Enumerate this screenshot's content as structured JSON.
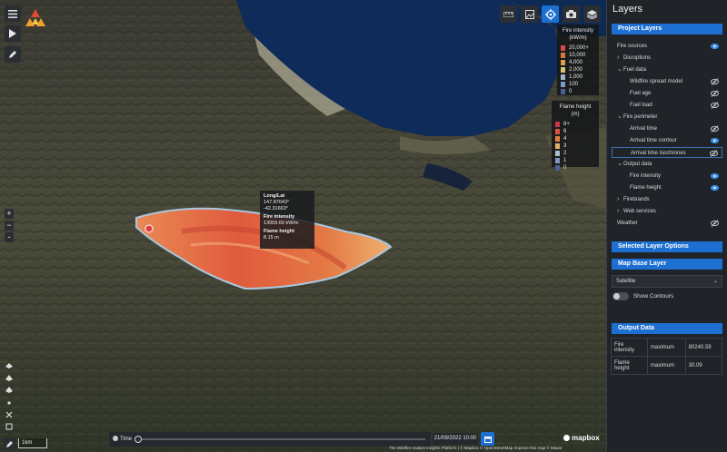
{
  "map": {
    "scale": "1km",
    "attribution": "The Wildfire Analyst Insights Platform | © Mapbox © OpenStreetMap Improve this map © Maxar",
    "mapbox_logo": "mapbox",
    "zoom_in": "+",
    "zoom_out": "−",
    "compass": "-"
  },
  "legends": {
    "fire_intensity": {
      "title": "Fire intensity (kW/m)",
      "items": [
        {
          "label": "20,000+",
          "color": "#d24a4a"
        },
        {
          "label": "10,000",
          "color": "#d9753e"
        },
        {
          "label": "4,000",
          "color": "#e0a146"
        },
        {
          "label": "2,000",
          "color": "#d8c274"
        },
        {
          "label": "1,000",
          "color": "#9fb4c8"
        },
        {
          "label": "100",
          "color": "#7f9ac4"
        },
        {
          "label": "0",
          "color": "#4a5f9c"
        }
      ]
    },
    "flame_height": {
      "title": "Flame height (m)",
      "items": [
        {
          "label": "8+",
          "color": "#c9364a"
        },
        {
          "label": "6",
          "color": "#d9533c"
        },
        {
          "label": "4",
          "color": "#e07f3f"
        },
        {
          "label": "3",
          "color": "#e2b065"
        },
        {
          "label": "2",
          "color": "#a9c0cf"
        },
        {
          "label": "1",
          "color": "#7e96c0"
        },
        {
          "label": "0",
          "color": "#4e5f98"
        }
      ]
    }
  },
  "tooltip": {
    "longlat_label": "Long/Lat",
    "longlat_value": "147.87643° -42.31663°",
    "intensity_label": "Fire intensity",
    "intensity_value": "13059.69 kW/m",
    "flame_label": "Flame height",
    "flame_value": "8.15 m"
  },
  "time": {
    "label": "Time",
    "progress": 0.0,
    "date": "21/09/2022 10:00"
  },
  "panel": {
    "title": "Layers",
    "project_layers": "Project Layers",
    "items": [
      {
        "label": "Fire sources",
        "caret": "",
        "indent": 0,
        "eye": "on"
      },
      {
        "label": "Disruptions",
        "caret": "›",
        "indent": 0,
        "eye": ""
      },
      {
        "label": "Fuel data",
        "caret": "⌄",
        "indent": 0,
        "eye": ""
      },
      {
        "label": "Wildfire spread model",
        "caret": "",
        "indent": 1,
        "eye": "off"
      },
      {
        "label": "Fuel age",
        "caret": "",
        "indent": 1,
        "eye": "off"
      },
      {
        "label": "Fuel load",
        "caret": "",
        "indent": 1,
        "eye": "off"
      },
      {
        "label": "Fire perimeter",
        "caret": "⌄",
        "indent": 0,
        "eye": ""
      },
      {
        "label": "Arrival time",
        "caret": "",
        "indent": 1,
        "eye": "off"
      },
      {
        "label": "Arrival time contour",
        "caret": "",
        "indent": 1,
        "eye": "on"
      },
      {
        "label": "Arrival time isochrones",
        "caret": "",
        "indent": 1,
        "eye": "off"
      },
      {
        "label": "Output data",
        "caret": "⌄",
        "indent": 0,
        "eye": ""
      },
      {
        "label": "Fire intensity",
        "caret": "",
        "indent": 1,
        "eye": "on"
      },
      {
        "label": "Flame height",
        "caret": "",
        "indent": 1,
        "eye": "on"
      },
      {
        "label": "Firebrands",
        "caret": "›",
        "indent": 0,
        "eye": ""
      },
      {
        "label": "Web services",
        "caret": "›",
        "indent": 0,
        "eye": ""
      },
      {
        "label": "Weather",
        "caret": "",
        "indent": 0,
        "eye": "off"
      }
    ],
    "selected_layer_options": "Selected Layer Options",
    "map_base_layer": "Map Base Layer",
    "base_layer_value": "Satellite",
    "show_contours": "Show Contours",
    "output_data": "Output Data",
    "output_rows": [
      {
        "name": "Fire intensity",
        "stat": "maximum",
        "value": "80240.59"
      },
      {
        "name": "Flame height",
        "stat": "maximum",
        "value": "30.09"
      }
    ]
  }
}
